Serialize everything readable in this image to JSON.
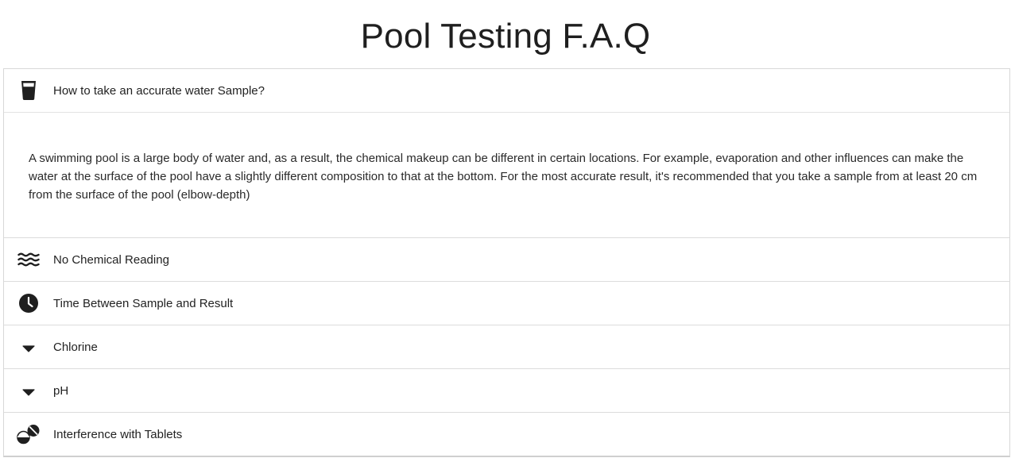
{
  "page": {
    "title": "Pool Testing F.A.Q"
  },
  "faq": {
    "items": [
      {
        "icon": "water-glass-icon",
        "question": "How to take an accurate water Sample?",
        "expanded": true,
        "answer": "A swimming pool is a large body of water and, as a result, the chemical makeup can be different in certain locations. For example, evaporation and other influences can make the water at the surface of the pool have a slightly different composition to that at the bottom. For the most accurate result, it's recommended that you take a sample from at least 20 cm from the surface of the pool (elbow-depth)"
      },
      {
        "icon": "water-waves-icon",
        "question": "No Chemical Reading",
        "expanded": false
      },
      {
        "icon": "clock-icon",
        "question": "Time Between Sample and Result",
        "expanded": false
      },
      {
        "icon": "caret-down-icon",
        "question": "Chlorine",
        "expanded": false
      },
      {
        "icon": "caret-down-icon",
        "question": "pH",
        "expanded": false
      },
      {
        "icon": "tablets-icon",
        "question": "Interference with Tablets",
        "expanded": false
      }
    ]
  }
}
